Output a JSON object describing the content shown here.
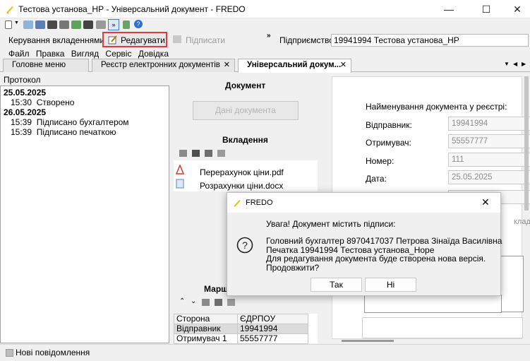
{
  "window": {
    "title": "Тестова установа_НР - Універсальний документ - FREDO"
  },
  "toolbar": {
    "attachments_label": "Керування вкладеннями",
    "edit_label": "Редагувати",
    "sign_label": "Підписати",
    "enterprise_label": "Підприємство",
    "enterprise_value": "19941994  Тестова установа_НР"
  },
  "menu": {
    "items": [
      "Файл",
      "Правка",
      "Вигляд",
      "Сервіс",
      "Довідка"
    ]
  },
  "tabs": [
    {
      "label": "Головне меню"
    },
    {
      "label": "Реєстр електронних документів"
    },
    {
      "label": "Універсальний докум..."
    }
  ],
  "protocol": {
    "header": "Протокол",
    "entries": [
      {
        "date": "25.05.2025",
        "time": "15:30",
        "event": "Створено"
      },
      {
        "date": "26.05.2025",
        "time": "15:39",
        "event": "Підписано бухгалтером"
      },
      {
        "date": "",
        "time": "15:39",
        "event": "Підписано печаткою"
      }
    ]
  },
  "document": {
    "section_title": "Документ",
    "data_button": "Дані документа",
    "attachments_title": "Вкладення",
    "files": [
      "Перерахунок ціни.pdf",
      "Розрахунки ціни.docx"
    ],
    "route_title": "Марш",
    "route_columns": [
      "Сторона",
      "ЄДРПОУ"
    ],
    "route_rows": [
      {
        "side": "Відправник",
        "code": "19941994"
      },
      {
        "side": "Отримувач 1",
        "code": "55557777"
      }
    ]
  },
  "form": {
    "heading": "Найменування документа у реєстрі:",
    "sender_label": "Відправник:",
    "sender_value": "19941994",
    "receiver_label": "Отримувач:",
    "receiver_value": "55557777",
    "number_label": "Номер:",
    "number_value": "111",
    "date_label": "Дата:",
    "date_value": "25.05.2025",
    "hint_partial": "кладе"
  },
  "dialog": {
    "title": "FREDO",
    "warning": "Увага! Документ містить підписи:",
    "line1": "Головний бухгалтер 8970417037 Петрова Зінаїда Василівна",
    "line2": "Печатка 19941994 Тестова установа_Норе",
    "line3": "Для редагування документа буде створена нова версія.",
    "line4": "Продовжити?",
    "yes": "Так",
    "no": "Ні"
  },
  "status": {
    "messages": "Нові повідомлення"
  },
  "colors": {
    "accent_red": "#e0393e",
    "selection": "#dcdcdc"
  }
}
